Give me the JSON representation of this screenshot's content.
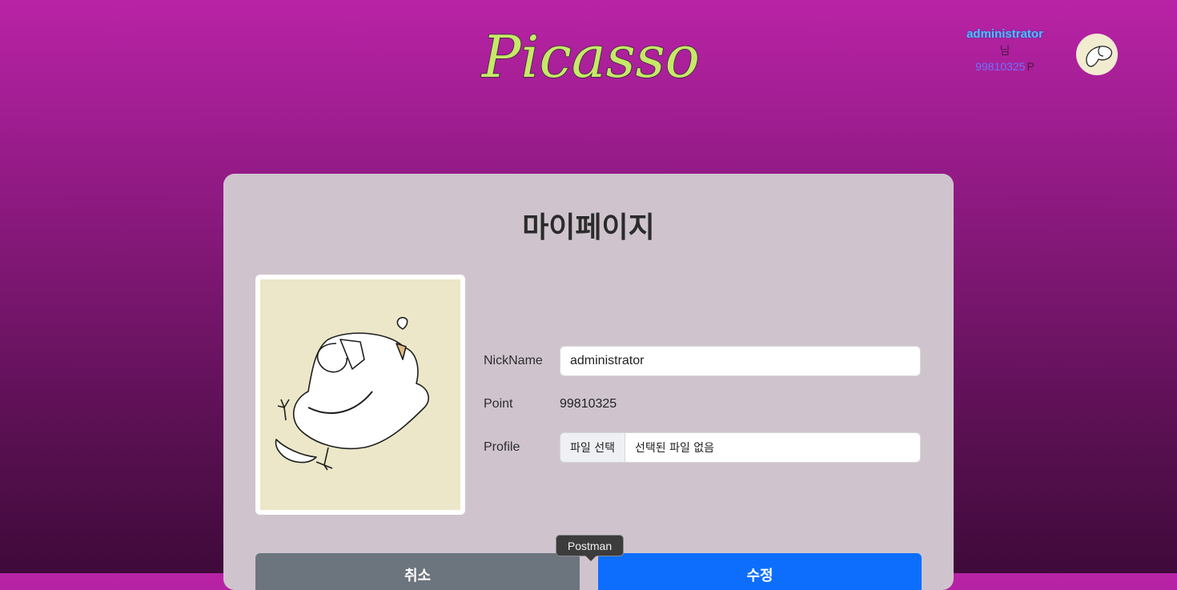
{
  "header": {
    "logo_text": "Picasso",
    "user": {
      "name": "administrator",
      "suffix": "님",
      "points": "99810325",
      "points_unit": "P",
      "avatar_icon": "chick-drawing-avatar-icon"
    }
  },
  "mypage": {
    "title": "마이페이지",
    "profile_image_icon": "chick-drawing-icon",
    "fields": {
      "nickname_label": "NickName",
      "nickname_value": "administrator",
      "point_label": "Point",
      "point_value": "99810325",
      "profile_label": "Profile",
      "file_button_label": "파일 선택",
      "file_status": "선택된 파일 없음"
    },
    "buttons": {
      "cancel_label": "취소",
      "edit_label": "수정"
    }
  },
  "tooltip": {
    "text": "Postman"
  },
  "colors": {
    "background_top": "#b923a6",
    "background_bottom": "#3f0a3a",
    "logo": "#c8e86a",
    "cancel_button": "#6c757d",
    "edit_button": "#0d6efd"
  }
}
